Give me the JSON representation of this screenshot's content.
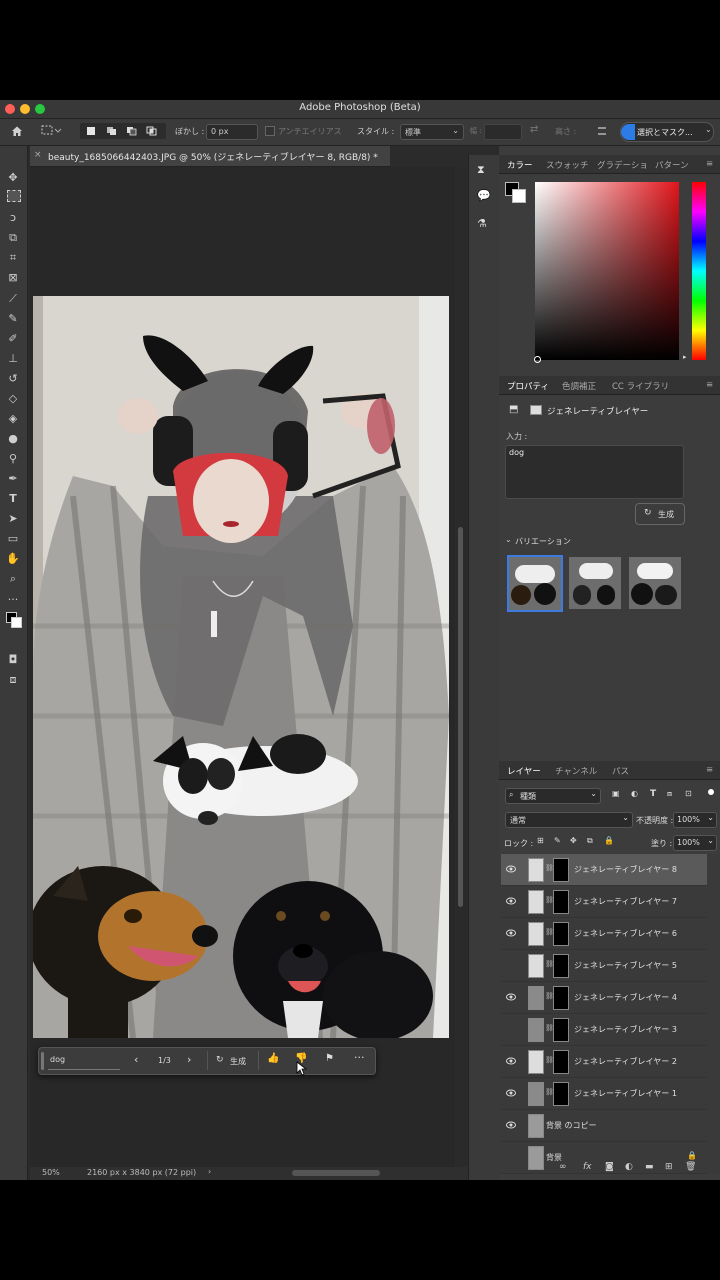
{
  "app": {
    "window_title": "Adobe Photoshop (Beta)",
    "document_tab": "beauty_1685066442403.JPG @ 50% (ジェネレーティブレイヤー 8, RGB/8) *"
  },
  "options": {
    "feather_label": "ぼかし :",
    "feather_value": "0 px",
    "antialias_label": "アンチエイリアス",
    "style_label": "スタイル :",
    "style_value": "標準",
    "width_label": "幅 :",
    "height_label": "高さ :",
    "select_mask_label": "選択とマスク..."
  },
  "color_panel": {
    "tabs": [
      "カラー",
      "スウォッチ",
      "グラデーショ",
      "パターン"
    ],
    "hue_color": "#e0151b"
  },
  "properties_panel": {
    "tabs": [
      "プロパティ",
      "色調補正",
      "CC ライブラリ"
    ],
    "layer_type": "ジェネレーティブレイヤー",
    "input_label": "入力 :",
    "prompt_value": "dog",
    "generate_label": "生成",
    "variations_label": "バリエーション"
  },
  "layers_panel": {
    "tabs": [
      "レイヤー",
      "チャンネル",
      "パス"
    ],
    "filter_label": "種類",
    "blend_mode": "通常",
    "opacity_label": "不透明度 :",
    "opacity_value": "100%",
    "lock_label": "ロック :",
    "fill_label": "塗り :",
    "fill_value": "100%",
    "layers": [
      {
        "name": "ジェネレーティブレイヤー 8",
        "visible": true,
        "selected": true
      },
      {
        "name": "ジェネレーティブレイヤー 7",
        "visible": true,
        "selected": false
      },
      {
        "name": "ジェネレーティブレイヤー 6",
        "visible": true,
        "selected": false
      },
      {
        "name": "ジェネレーティブレイヤー 5",
        "visible": false,
        "selected": false
      },
      {
        "name": "ジェネレーティブレイヤー 4",
        "visible": true,
        "selected": false
      },
      {
        "name": "ジェネレーティブレイヤー 3",
        "visible": false,
        "selected": false
      },
      {
        "name": "ジェネレーティブレイヤー 2",
        "visible": true,
        "selected": false
      },
      {
        "name": "ジェネレーティブレイヤー 1",
        "visible": true,
        "selected": false
      },
      {
        "name": "背景 のコピー",
        "visible": true,
        "selected": false
      },
      {
        "name": "背景",
        "visible": false,
        "selected": false,
        "locked": true
      }
    ]
  },
  "context_bar": {
    "prompt_value": "dog",
    "page_indicator": "1/3",
    "generate_label": "生成"
  },
  "status_bar": {
    "zoom": "50%",
    "doc_info": "2160 px x 3840 px (72 ppi)"
  }
}
